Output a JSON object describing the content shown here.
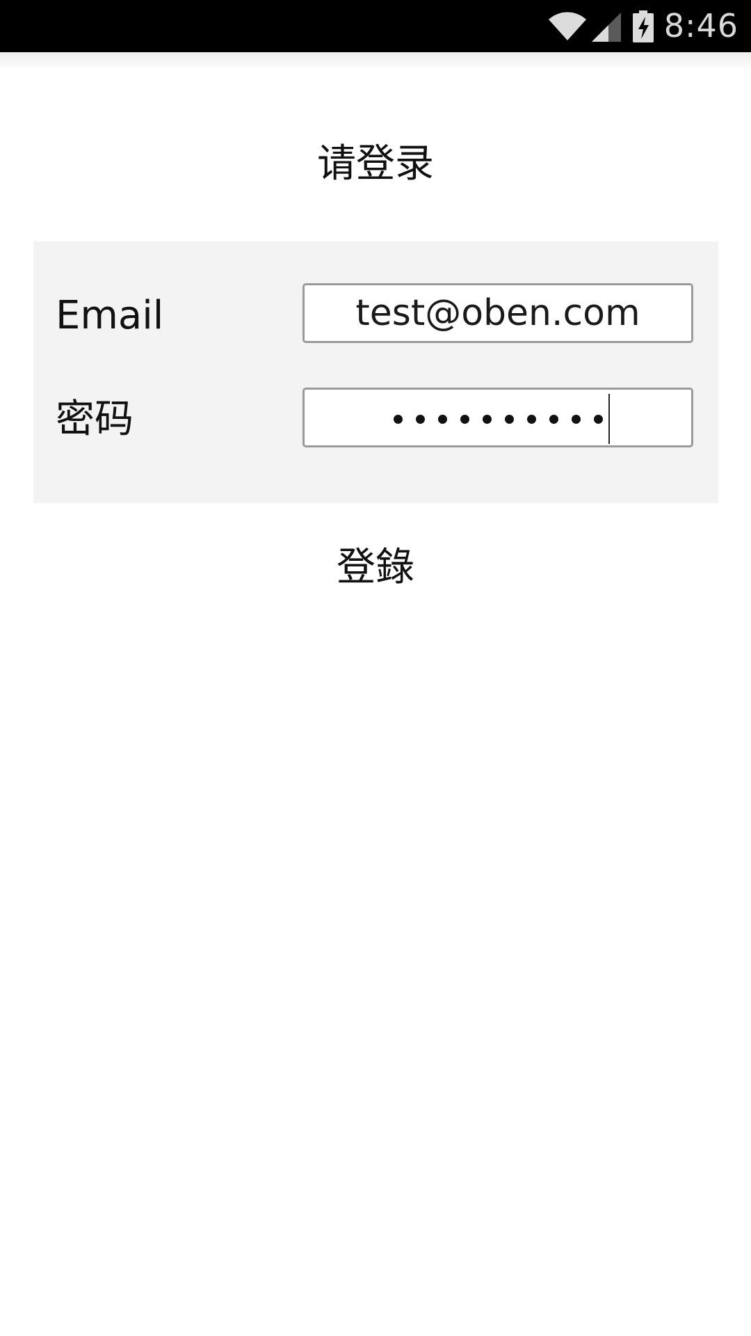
{
  "status_bar": {
    "time": "8:46",
    "icons": [
      "wifi-icon",
      "cell-signal-icon",
      "battery-charging-icon"
    ]
  },
  "title": "请登录",
  "form": {
    "email": {
      "label": "Email",
      "value": "test@oben.com"
    },
    "password": {
      "label": "密码",
      "masked_length": 10
    }
  },
  "login_button": "登錄"
}
